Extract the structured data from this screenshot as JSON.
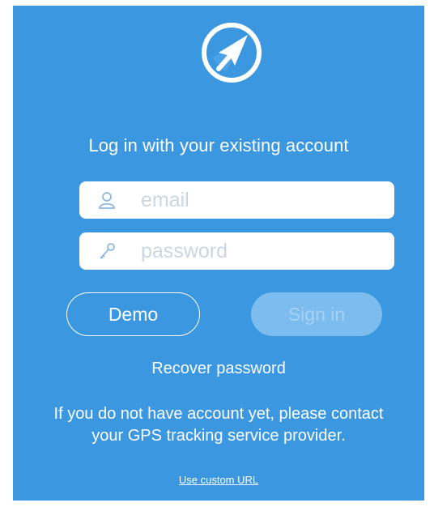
{
  "app": {
    "logo_icon": "navigation-arrow-icon",
    "background_color": "#3a97e0"
  },
  "login": {
    "title": "Log in with your existing account",
    "email_placeholder": "email",
    "email_icon": "user-icon",
    "password_placeholder": "password",
    "password_icon": "key-icon",
    "demo_label": "Demo",
    "signin_label": "Sign in",
    "recover_label": "Recover password",
    "info_text": "If you do not have account yet, please contact your GPS tracking service provider.",
    "custom_url_label": "Use custom URL"
  }
}
